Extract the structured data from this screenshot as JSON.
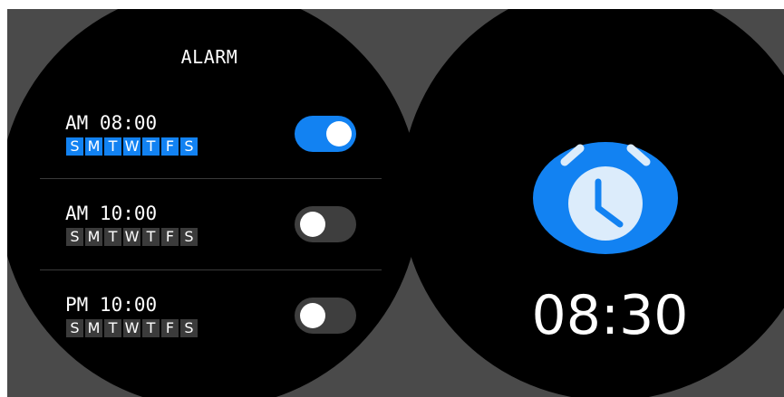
{
  "colors": {
    "accent": "#1282f2",
    "screen_bg": "#000000",
    "backdrop": "#4a4a4a",
    "chip_off": "#3b3b3b",
    "toggle_off": "#3e3e3e",
    "clock_face": "#dcecfb"
  },
  "alarm_list": {
    "title": "ALARM",
    "alarms": [
      {
        "time": "AM 08:00",
        "enabled": true,
        "days": [
          {
            "label": "S",
            "active": true
          },
          {
            "label": "M",
            "active": true
          },
          {
            "label": "T",
            "active": true
          },
          {
            "label": "W",
            "active": true
          },
          {
            "label": "T",
            "active": true
          },
          {
            "label": "F",
            "active": true
          },
          {
            "label": "S",
            "active": true
          }
        ]
      },
      {
        "time": "AM 10:00",
        "enabled": false,
        "days": [
          {
            "label": "S",
            "active": false
          },
          {
            "label": "M",
            "active": false
          },
          {
            "label": "T",
            "active": false
          },
          {
            "label": "W",
            "active": false
          },
          {
            "label": "T",
            "active": false
          },
          {
            "label": "F",
            "active": false
          },
          {
            "label": "S",
            "active": false
          }
        ]
      },
      {
        "time": "PM 10:00",
        "enabled": false,
        "days": [
          {
            "label": "S",
            "active": false
          },
          {
            "label": "M",
            "active": false
          },
          {
            "label": "T",
            "active": false
          },
          {
            "label": "W",
            "active": false
          },
          {
            "label": "T",
            "active": false
          },
          {
            "label": "F",
            "active": false
          },
          {
            "label": "S",
            "active": false
          }
        ]
      }
    ]
  },
  "ringing": {
    "icon": "alarm-clock-icon",
    "time": "08:30"
  }
}
